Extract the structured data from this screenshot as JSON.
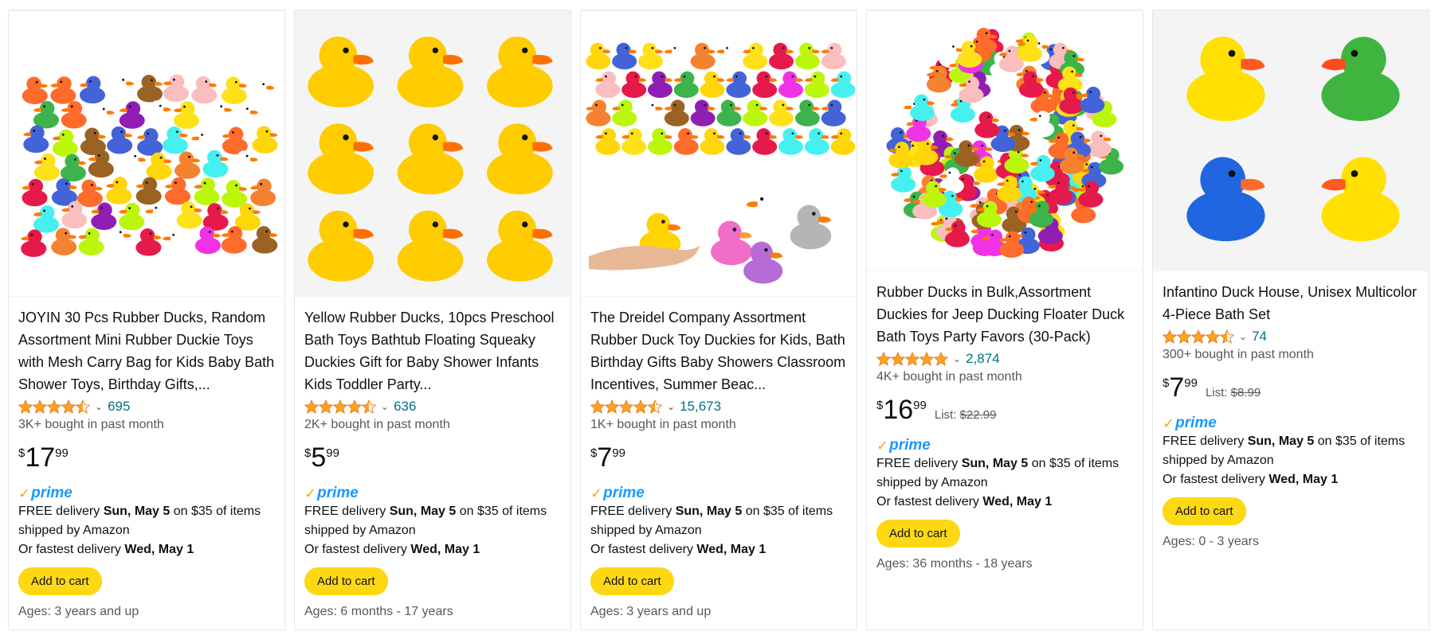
{
  "products": [
    {
      "title": "JOYIN 30 Pcs Rubber Ducks, Random Assortment Mini Rubber Duckie Toys with Mesh Carry Bag for Kids Baby Bath Shower Toys, Birthday Gifts,...",
      "rating": 4.5,
      "review_count": "695",
      "bought": "3K+ bought in past month",
      "price_symbol": "$",
      "price_whole": "17",
      "price_fraction": "99",
      "list_label": "",
      "list_price": "",
      "prime_label": "prime",
      "delivery_prefix": "FREE delivery ",
      "delivery_date": "Sun, May 5",
      "delivery_suffix": " on $35 of items shipped by Amazon",
      "fastest_prefix": "Or fastest delivery ",
      "fastest_date": "Wed, May 1",
      "cart_label": "Add to cart",
      "ages": "Ages: 3 years and up",
      "image_icon": "assorted-ducks-image"
    },
    {
      "title": "Yellow Rubber Ducks, 10pcs Preschool Bath Toys Bathtub Floating Squeaky Duckies Gift for Baby Shower Infants Kids Toddler Party...",
      "rating": 4.5,
      "review_count": "636",
      "bought": "2K+ bought in past month",
      "price_symbol": "$",
      "price_whole": "5",
      "price_fraction": "99",
      "list_label": "",
      "list_price": "",
      "prime_label": "prime",
      "delivery_prefix": "FREE delivery ",
      "delivery_date": "Sun, May 5",
      "delivery_suffix": " on $35 of items shipped by Amazon",
      "fastest_prefix": "Or fastest delivery ",
      "fastest_date": "Wed, May 1",
      "cart_label": "Add to cart",
      "ages": "Ages: 6 months - 17 years",
      "image_icon": "yellow-ducks-grid-image"
    },
    {
      "title": "The Dreidel Company Assortment Rubber Duck Toy Duckies for Kids, Bath Birthday Gifts Baby Showers Classroom Incentives, Summer Beac...",
      "rating": 4.5,
      "review_count": "15,673",
      "bought": "1K+ bought in past month",
      "price_symbol": "$",
      "price_whole": "7",
      "price_fraction": "99",
      "list_label": "",
      "list_price": "",
      "prime_label": "prime",
      "delivery_prefix": "FREE delivery ",
      "delivery_date": "Sun, May 5",
      "delivery_suffix": " on $35 of items shipped by Amazon",
      "fastest_prefix": "Or fastest delivery ",
      "fastest_date": "Wed, May 1",
      "cart_label": "Add to cart",
      "ages": "Ages: 3 years and up",
      "image_icon": "dreidel-ducks-image"
    },
    {
      "title": "Rubber Ducks in Bulk,Assortment Duckies for Jeep Ducking Floater Duck Bath Toys Party Favors (30-Pack)",
      "rating": 5,
      "review_count": "2,874",
      "bought": "4K+ bought in past month",
      "price_symbol": "$",
      "price_whole": "16",
      "price_fraction": "99",
      "list_label": "List: ",
      "list_price": "$22.99",
      "prime_label": "prime",
      "delivery_prefix": "FREE delivery ",
      "delivery_date": "Sun, May 5",
      "delivery_suffix": " on $35 of items shipped by Amazon",
      "fastest_prefix": "Or fastest delivery ",
      "fastest_date": "Wed, May 1",
      "cart_label": "Add to cart",
      "ages": "Ages: 36 months - 18 years",
      "image_icon": "bulk-ducks-image"
    },
    {
      "title": "Infantino Duck House, Unisex Multicolor 4-Piece Bath Set",
      "rating": 4.5,
      "review_count": "74",
      "bought": "300+ bought in past month",
      "price_symbol": "$",
      "price_whole": "7",
      "price_fraction": "99",
      "list_label": "List: ",
      "list_price": "$8.99",
      "prime_label": "prime",
      "delivery_prefix": "FREE delivery ",
      "delivery_date": "Sun, May 5",
      "delivery_suffix": " on $35 of items shipped by Amazon",
      "fastest_prefix": "Or fastest delivery ",
      "fastest_date": "Wed, May 1",
      "cart_label": "Add to cart",
      "ages": "Ages: 0 - 3 years",
      "image_icon": "four-duck-set-image"
    }
  ],
  "colors": {
    "star": "#ffa41c",
    "link": "#007185",
    "button": "#ffd814",
    "prime": "#1a98ff"
  }
}
